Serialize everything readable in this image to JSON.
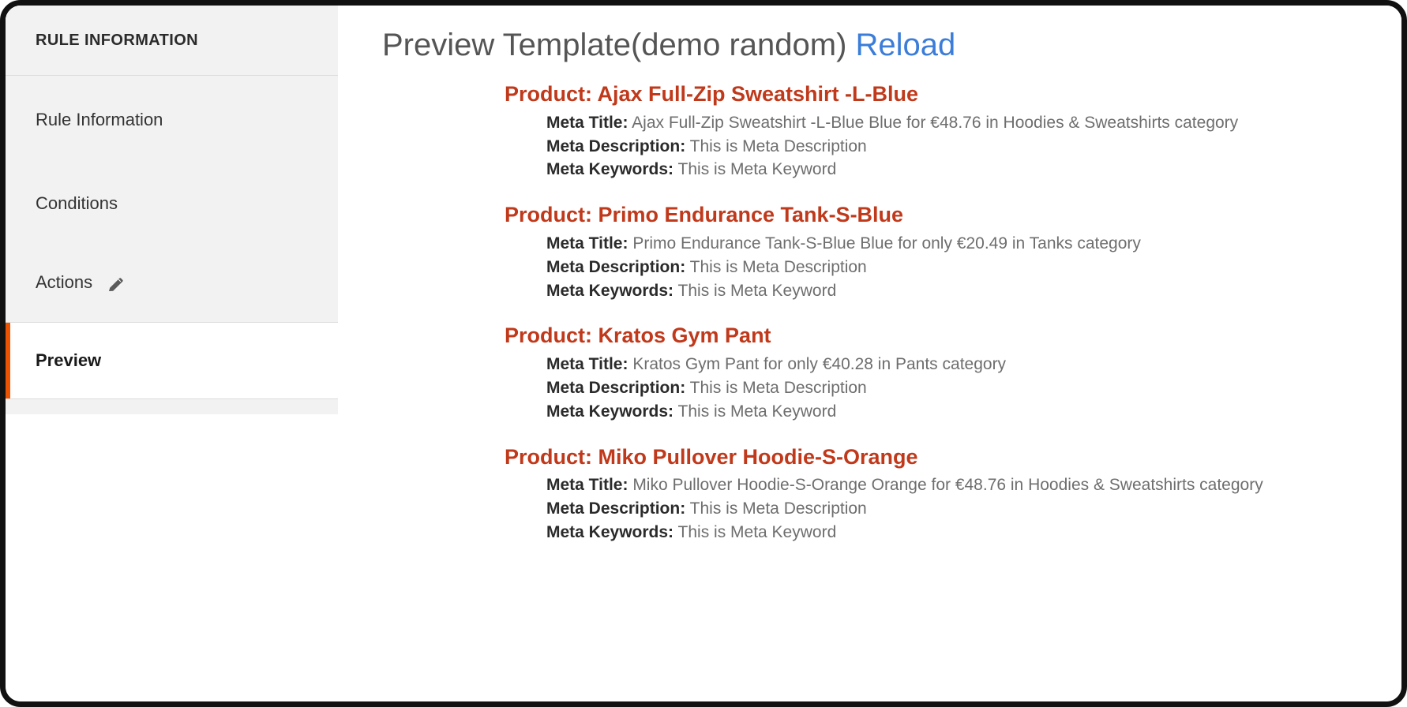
{
  "sidebar": {
    "header": "RULE INFORMATION",
    "items": [
      {
        "label": "Rule Information",
        "active": false,
        "icon": null
      },
      {
        "label": "Conditions",
        "active": false,
        "icon": null
      },
      {
        "label": "Actions",
        "active": false,
        "icon": "pencil-icon"
      },
      {
        "label": "Preview",
        "active": true,
        "icon": null
      }
    ]
  },
  "main": {
    "title": "Preview Template(demo random)",
    "reload_label": "Reload",
    "meta_labels": {
      "title": "Meta Title:",
      "description": "Meta Description:",
      "keywords": "Meta Keywords:"
    },
    "products": [
      {
        "heading": "Product: Ajax Full-Zip Sweatshirt -L-Blue",
        "meta_title": "Ajax Full-Zip Sweatshirt -L-Blue Blue for €48.76 in Hoodies & Sweatshirts category",
        "meta_description": "This is Meta Description",
        "meta_keywords": "This is Meta Keyword"
      },
      {
        "heading": "Product: Primo Endurance Tank-S-Blue",
        "meta_title": "Primo Endurance Tank-S-Blue Blue for only €20.49 in Tanks category",
        "meta_description": "This is Meta Description",
        "meta_keywords": "This is Meta Keyword"
      },
      {
        "heading": "Product: Kratos Gym Pant",
        "meta_title": "Kratos Gym Pant for only €40.28 in Pants category",
        "meta_description": "This is Meta Description",
        "meta_keywords": "This is Meta Keyword"
      },
      {
        "heading": "Product: Miko Pullover Hoodie-S-Orange",
        "meta_title": "Miko Pullover Hoodie-S-Orange Orange for €48.76 in Hoodies & Sweatshirts category",
        "meta_description": "This is Meta Description",
        "meta_keywords": "This is Meta Keyword"
      }
    ]
  },
  "colors": {
    "accent_orange": "#eb5202",
    "product_heading": "#c0391b",
    "link_blue": "#3b7dd8",
    "sidebar_bg": "#f2f2f2",
    "text_muted": "#6e6e6e"
  }
}
